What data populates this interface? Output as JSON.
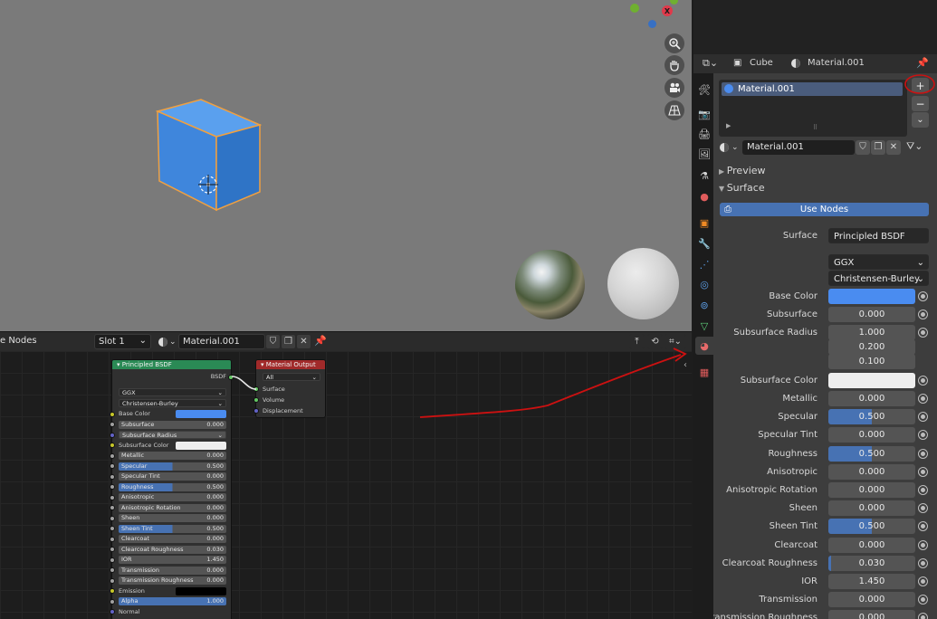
{
  "viewport": {
    "nav_icons": [
      "zoom-icon",
      "hand-pan-icon",
      "camera-icon",
      "grid-ortho-icon"
    ],
    "gizmo_x_label": "X"
  },
  "node_editor": {
    "header": {
      "editor_label": "e Nodes",
      "slot": "Slot 1",
      "material": "Material.001"
    },
    "principled": {
      "title": "Principled BSDF",
      "output": "BSDF",
      "distribution": "GGX",
      "subsurface_method": "Christensen-Burley",
      "rows": [
        {
          "label": "Base Color"
        },
        {
          "label": "Subsurface",
          "value": "0.000"
        },
        {
          "label": "Subsurface Radius"
        },
        {
          "label": "Subsurface Color"
        },
        {
          "label": "Metallic",
          "value": "0.000"
        },
        {
          "label": "Specular",
          "value": "0.500"
        },
        {
          "label": "Specular Tint",
          "value": "0.000"
        },
        {
          "label": "Roughness",
          "value": "0.500"
        },
        {
          "label": "Anisotropic",
          "value": "0.000"
        },
        {
          "label": "Anisotropic Rotation",
          "value": "0.000"
        },
        {
          "label": "Sheen",
          "value": "0.000"
        },
        {
          "label": "Sheen Tint",
          "value": "0.500"
        },
        {
          "label": "Clearcoat",
          "value": "0.000"
        },
        {
          "label": "Clearcoat Roughness",
          "value": "0.030"
        },
        {
          "label": "IOR",
          "value": "1.450"
        },
        {
          "label": "Transmission",
          "value": "0.000"
        },
        {
          "label": "Transmission Roughness",
          "value": "0.000"
        },
        {
          "label": "Emission"
        },
        {
          "label": "Alpha",
          "value": "1.000"
        },
        {
          "label": "Normal"
        }
      ]
    },
    "output_node": {
      "title": "Material Output",
      "target": "All",
      "inputs": [
        "Surface",
        "Volume",
        "Displacement"
      ]
    }
  },
  "properties": {
    "header": {
      "object": "Cube",
      "material": "Material.001"
    },
    "slot_list": [
      "Material.001"
    ],
    "slot_buttons": [
      "+",
      "−",
      "⌄"
    ],
    "material_field": "Material.001",
    "panels": {
      "preview": "Preview",
      "surface": "Surface"
    },
    "use_nodes": "Use Nodes",
    "surface_label": "Surface",
    "surface_shader": "Principled BSDF",
    "distribution": "GGX",
    "subsurface_method": "Christensen-Burley",
    "base_color_label": "Base Color",
    "base_color": "#4a8cf0",
    "subsurface_label": "Subsurface",
    "subsurface": "0.000",
    "subsurface_radius_label": "Subsurface Radius",
    "subsurface_radius": [
      "1.000",
      "0.200",
      "0.100"
    ],
    "subsurface_color_label": "Subsurface Color",
    "subsurface_color": "#eeeeee",
    "sliders": [
      {
        "label": "Metallic",
        "value": "0.000",
        "fill": 0
      },
      {
        "label": "Specular",
        "value": "0.500",
        "fill": 0.5
      },
      {
        "label": "Specular Tint",
        "value": "0.000",
        "fill": 0
      },
      {
        "label": "Roughness",
        "value": "0.500",
        "fill": 0.5
      },
      {
        "label": "Anisotropic",
        "value": "0.000",
        "fill": 0
      },
      {
        "label": "Anisotropic Rotation",
        "value": "0.000",
        "fill": 0
      },
      {
        "label": "Sheen",
        "value": "0.000",
        "fill": 0
      },
      {
        "label": "Sheen Tint",
        "value": "0.500",
        "fill": 0.5
      },
      {
        "label": "Clearcoat",
        "value": "0.000",
        "fill": 0
      },
      {
        "label": "Clearcoat Roughness",
        "value": "0.030",
        "fill": 0.03
      },
      {
        "label": "IOR",
        "value": "1.450",
        "fill": 0
      },
      {
        "label": "Transmission",
        "value": "0.000",
        "fill": 0
      },
      {
        "label": "Transmission Roughness",
        "value": "0.000",
        "fill": 0
      }
    ]
  },
  "colors": {
    "accent": "#4772b3",
    "annotation": "#cc1111"
  }
}
